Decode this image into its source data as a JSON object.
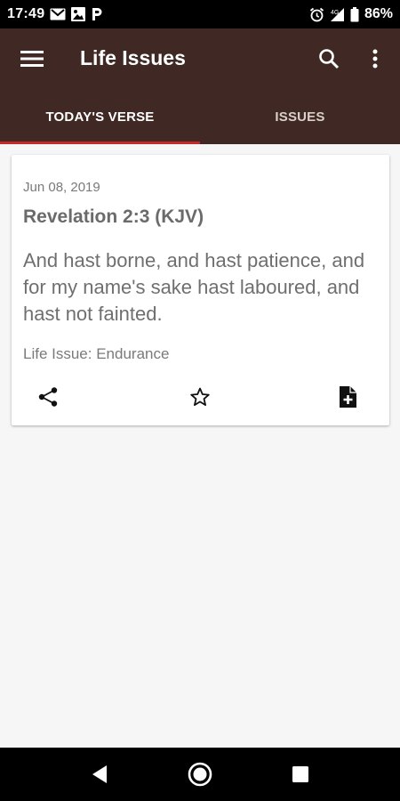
{
  "status_bar": {
    "time": "17:49",
    "battery": "86%",
    "left_icons": [
      "gmail-icon",
      "photo-icon",
      "parking-icon"
    ],
    "right_icons": [
      "alarm-icon",
      "signal-icon",
      "battery-icon"
    ]
  },
  "header": {
    "title": "Life Issues",
    "background": "#402924",
    "accent": "#c62828"
  },
  "tabs": [
    {
      "label": "TODAY'S VERSE",
      "active": true
    },
    {
      "label": "ISSUES",
      "active": false
    }
  ],
  "verse_card": {
    "date": "Jun 08, 2019",
    "reference": "Revelation 2:3 (KJV)",
    "text": "And hast borne, and hast patience, and for my name's sake hast laboured, and hast not fainted.",
    "life_issue": "Life Issue: Endurance",
    "actions": [
      "share-icon",
      "star-icon",
      "add-note-icon"
    ]
  },
  "nav_bar": {
    "buttons": [
      "back-icon",
      "home-icon",
      "recents-icon"
    ]
  }
}
